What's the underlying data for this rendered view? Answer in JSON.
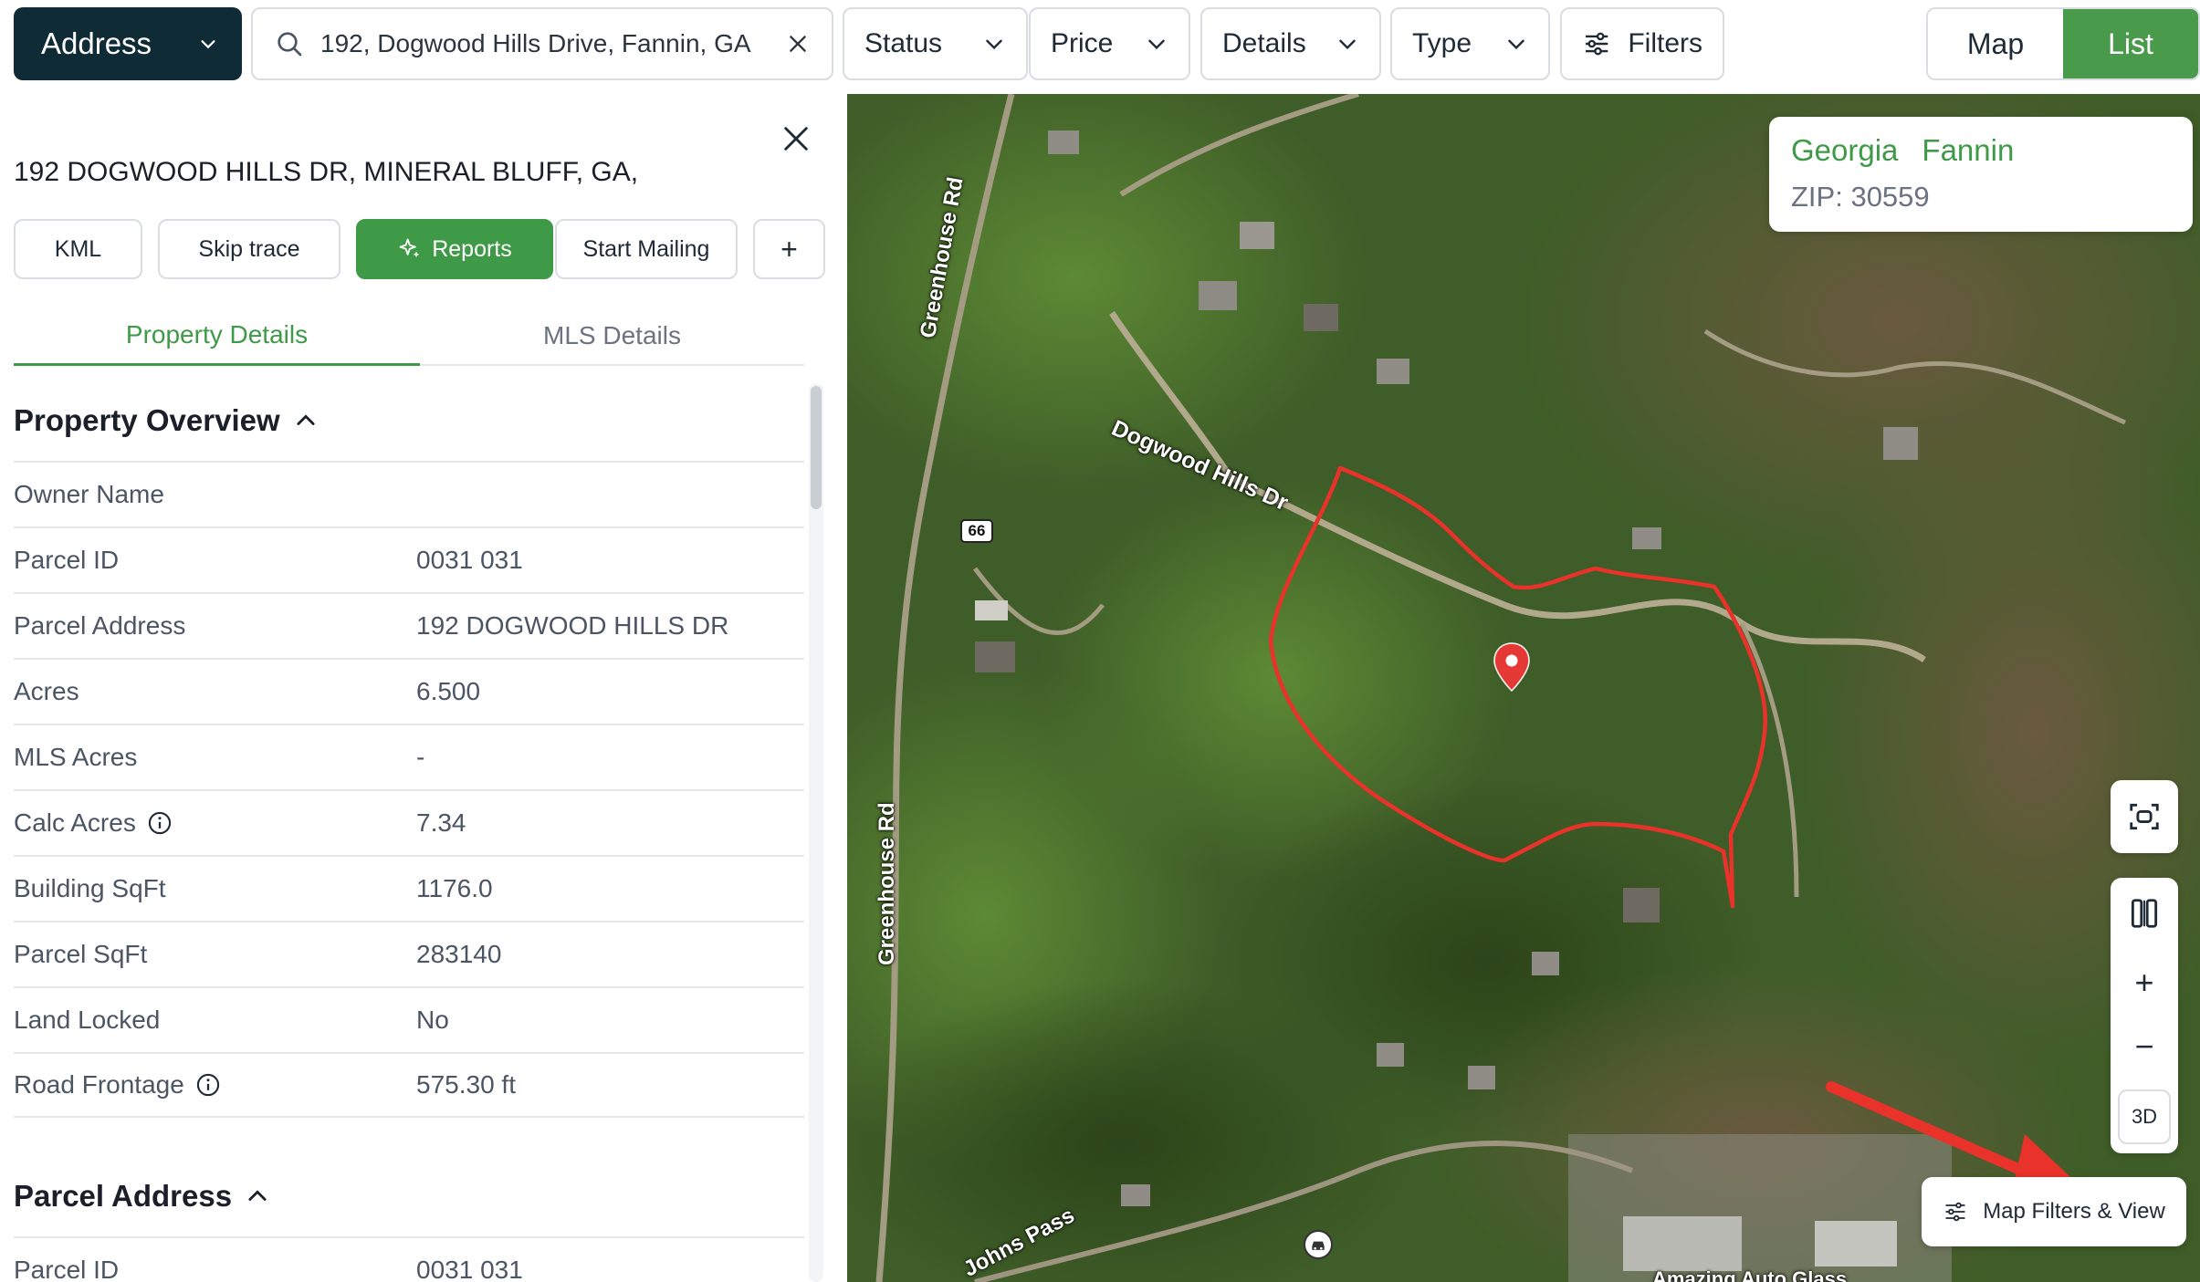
{
  "toolbar": {
    "address_select": "Address",
    "search_value": "192, Dogwood Hills Drive, Fannin, GA",
    "filters": [
      "Status",
      "Price",
      "Details",
      "Type"
    ],
    "filters_button": "Filters",
    "view_toggle": {
      "map": "Map",
      "list": "List",
      "active": "List"
    }
  },
  "panel": {
    "address": "192 DOGWOOD HILLS DR, MINERAL BLUFF, GA,",
    "actions": {
      "kml": "KML",
      "skip_trace": "Skip trace",
      "reports": "Reports",
      "start_mailing": "Start Mailing",
      "add": "+"
    },
    "tabs": {
      "property_details": "Property Details",
      "mls_details": "MLS Details",
      "active": "Property Details"
    },
    "overview_title": "Property Overview",
    "rows": [
      {
        "label": "Owner Name",
        "value": ""
      },
      {
        "label": "Parcel ID",
        "value": "0031 031"
      },
      {
        "label": "Parcel Address",
        "value": "192 DOGWOOD HILLS DR"
      },
      {
        "label": "Acres",
        "value": "6.500"
      },
      {
        "label": "MLS Acres",
        "value": "-"
      },
      {
        "label": "Calc Acres",
        "value": "7.34"
      },
      {
        "label": "Building SqFt",
        "value": "1176.0"
      },
      {
        "label": "Parcel SqFt",
        "value": "283140"
      },
      {
        "label": "Land Locked",
        "value": "No"
      },
      {
        "label": "Road Frontage",
        "value": "575.30 ft"
      }
    ],
    "parcel_address_title": "Parcel Address",
    "parcel_address_first_row": {
      "label": "Parcel ID",
      "value": "0031 031"
    }
  },
  "map": {
    "location_card": {
      "state": "Georgia",
      "county": "Fannin",
      "zip": "ZIP: 30559"
    },
    "labels": {
      "greenhouse_rd_north": "Greenhouse Rd",
      "greenhouse_rd_south": "Greenhouse Rd",
      "dogwood_hills_dr": "Dogwood Hills Dr",
      "route_shield": "66",
      "johns_pass": "Johns Pass",
      "business": "Amazing Auto Glass"
    },
    "controls": {
      "zoom_in": "+",
      "zoom_out": "−",
      "three_d": "3D",
      "map_filters": "Map Filters & View"
    },
    "colors": {
      "parcel_outline": "#e8322a",
      "pin": "#e53935",
      "arrow": "#e8322a",
      "accent": "#3f9a48"
    }
  }
}
